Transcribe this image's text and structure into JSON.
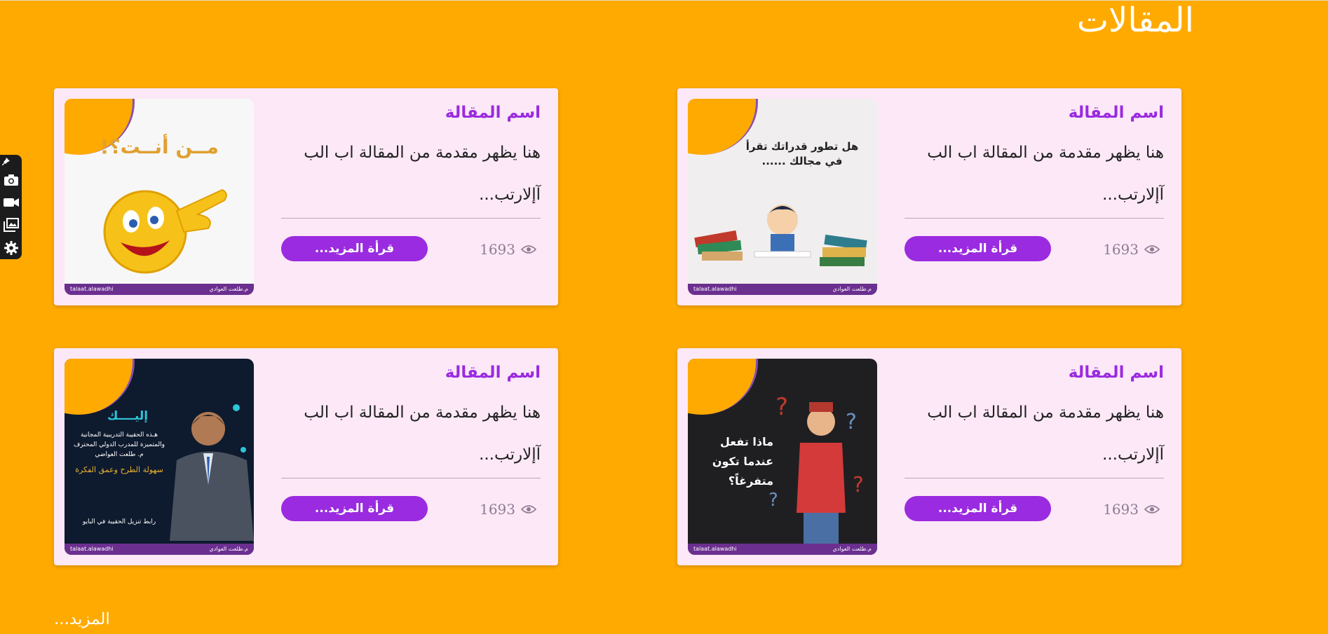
{
  "page": {
    "title": "المقالات",
    "more_link": "المزيد..."
  },
  "colors": {
    "background": "#FFAA00",
    "card": "#FCE8F7",
    "accent": "#9a2be0"
  },
  "toolbar": {
    "icons": [
      "pin-icon",
      "camera-icon",
      "video-icon",
      "gallery-icon",
      "gear-icon"
    ]
  },
  "articles": [
    {
      "title": "اسم المقالة",
      "excerpt": "هنا يظهر مقدمة من المقالة اب الب آإلارتب...",
      "views": "1693",
      "button": "قرأة المزيد...",
      "image": {
        "headline": "هل تطور قدراتك تقرأ في مجالك ......",
        "footer_left": "talaat.alawadhi",
        "footer_right": "م.طلعت العوادي"
      }
    },
    {
      "title": "اسم المقالة",
      "excerpt": "هنا يظهر مقدمة من المقالة اب الب آإلارتب...",
      "views": "1693",
      "button": "قرأة المزيد...",
      "image": {
        "headline": "مــن أنــت؟!",
        "footer_left": "talaat.alawadhi",
        "footer_right": "م.طلعت العوادي"
      }
    },
    {
      "title": "اسم المقالة",
      "excerpt": "هنا يظهر مقدمة من المقالة اب الب آإلارتب...",
      "views": "1693",
      "button": "قرأة المزيد...",
      "image": {
        "headline": "ماذا تفعل عندما تكون متفرغاً؟",
        "footer_left": "talaat.alawadhi",
        "footer_right": "م.طلعت العوادي"
      }
    },
    {
      "title": "اسم المقالة",
      "excerpt": "هنا يظهر مقدمة من المقالة اب الب آإلارتب...",
      "views": "1693",
      "button": "قرأة المزيد...",
      "image": {
        "headline": "إليــــك",
        "sub": "هـذه الحقيبة التدريبية المجانية والمتميزة للمدرب الدولي المحترف م. طلعت العواضي",
        "tag": "سهولة الطرح وعمق الفكرة",
        "link": "رابط تنزيل الحقيبة في البايو",
        "footer_left": "talaat.alawadhi",
        "footer_right": "م.طلعت العوادي"
      }
    }
  ]
}
